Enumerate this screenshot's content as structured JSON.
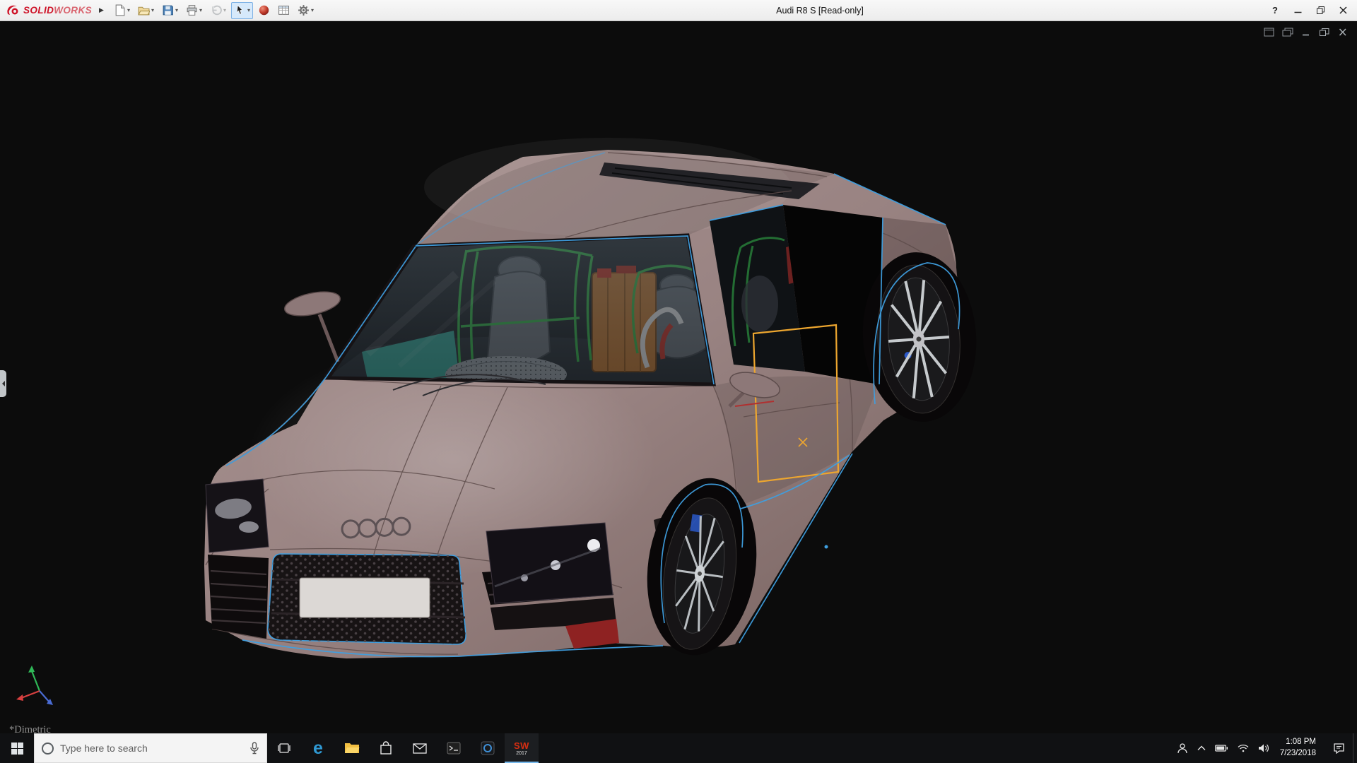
{
  "app": {
    "brand_solid": "SOLID",
    "brand_works": "WORKS",
    "title": "Audi R8 S [Read-only]",
    "help_label": "?",
    "window_controls": [
      "minimize",
      "restore",
      "close"
    ]
  },
  "toolbar": {
    "tools": [
      "new-document",
      "open",
      "save",
      "print",
      "undo",
      "select",
      "appearances",
      "design-table",
      "options"
    ]
  },
  "viewport": {
    "view_label": "*Dimetric",
    "background_color": "#0c0c0c",
    "body_color": "#9a8482",
    "edge_highlight_color": "#3f9fe0",
    "selection_color": "#eda62f",
    "cage_color": "#3bb54d",
    "interior_accent_color": "#3fae9e",
    "document_window_controls": [
      "new-window",
      "cascade",
      "minimize",
      "restore",
      "close"
    ]
  },
  "taskbar": {
    "search_placeholder": "Type here to search",
    "edge_glyph": "e",
    "sw_badge_top": "SW",
    "sw_badge_year": "2017",
    "apps": [
      "start",
      "search",
      "task-view",
      "edge",
      "file-explorer",
      "store",
      "mail",
      "command-prompt",
      "media-player",
      "solidworks-2017"
    ],
    "tray_icons": [
      "people",
      "hidden-icons",
      "battery",
      "network",
      "volume"
    ],
    "clock_time": "1:08 PM",
    "clock_date": "7/23/2018"
  }
}
